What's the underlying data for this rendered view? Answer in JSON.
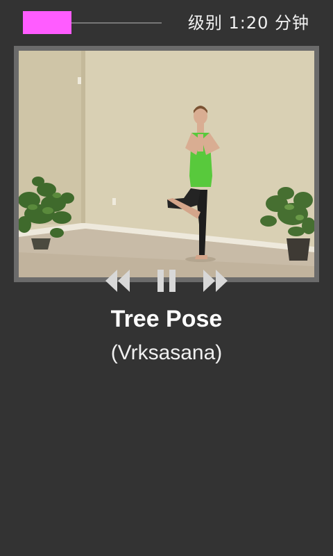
{
  "header": {
    "level_label": "级别 1:20 分钟",
    "progress": 0.35,
    "progress_color": "#ff5cff"
  },
  "video": {
    "scene": "woman-tree-pose-photo"
  },
  "controls": {
    "rewind_icon": "rewind-icon",
    "pause_icon": "pause-icon",
    "forward_icon": "fast-forward-icon",
    "icon_color": "#d8d8d8"
  },
  "pose": {
    "name": "Tree Pose",
    "sanskrit": "(Vrksasana)"
  }
}
